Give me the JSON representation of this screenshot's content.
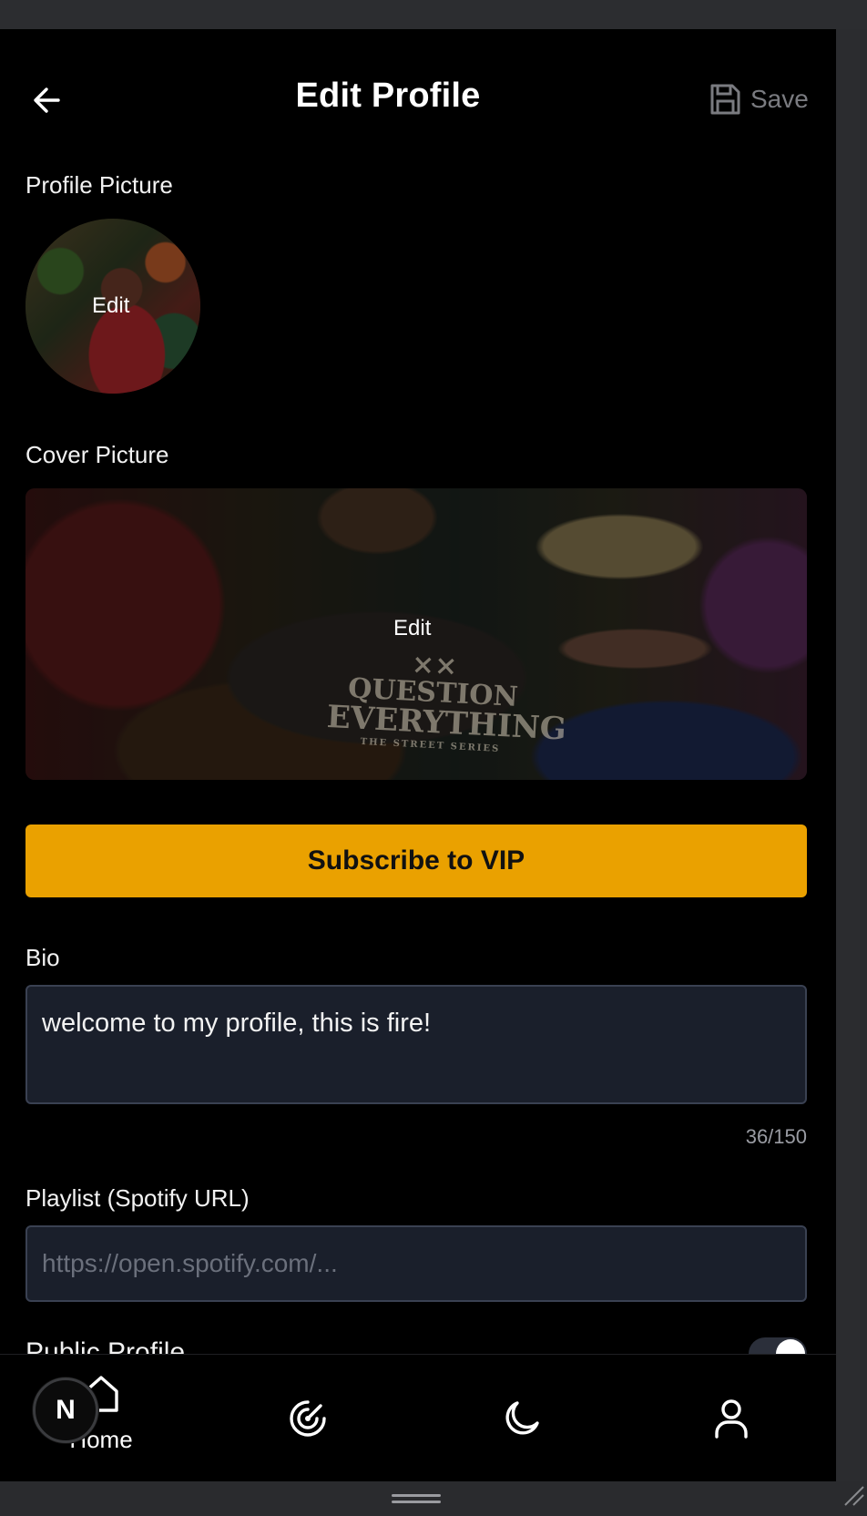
{
  "header": {
    "title": "Edit Profile",
    "save_label": "Save"
  },
  "profile_picture": {
    "label": "Profile Picture",
    "edit_label": "Edit"
  },
  "cover_picture": {
    "label": "Cover Picture",
    "edit_label": "Edit",
    "shirt_text": [
      "×× QUESTION",
      "EVERYTHING",
      "THE STREET SERIES"
    ]
  },
  "vip": {
    "label": "Subscribe to VIP",
    "color": "#eaa100"
  },
  "bio": {
    "label": "Bio",
    "value": "welcome to my profile, this is fire!",
    "counter": "36/150"
  },
  "playlist": {
    "label": "Playlist (Spotify URL)",
    "placeholder": "https://open.spotify.com/..."
  },
  "public_profile": {
    "label": "Public Profile",
    "enabled": true
  },
  "nav": {
    "items": [
      {
        "name": "home",
        "label": "Home",
        "icon": "home-icon"
      },
      {
        "name": "radar",
        "label": "",
        "icon": "radar-icon"
      },
      {
        "name": "night",
        "label": "",
        "icon": "moon-icon"
      },
      {
        "name": "profile",
        "label": "",
        "icon": "user-icon"
      }
    ]
  },
  "dev_badge": {
    "letter": "N"
  }
}
